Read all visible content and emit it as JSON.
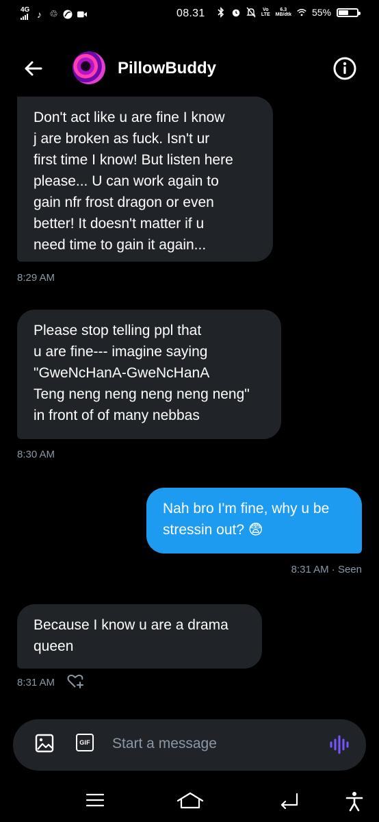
{
  "status_bar": {
    "network": "4G",
    "time": "08.31",
    "volte_line1": "Vo",
    "volte_line2": "LTE",
    "speed_line1": "6.3",
    "speed_line2": "MB/dtk",
    "battery_percent": "55%",
    "battery_level": 0.55
  },
  "header": {
    "title": "PillowBuddy"
  },
  "messages": [
    {
      "text": "Don't act like u are fine I know\nj are broken as fuck. Isn't ur\nfirst time I know! But listen here\nplease... U can work again to\ngain nfr frost dragon or even\nbetter! It doesn't matter if u\nneed time to gain it again...",
      "time": "8:29 AM"
    },
    {
      "text": "Please stop telling ppl that\nu are fine--- imagine saying\n\"GweNcHanA-GweNcHanA\nTeng neng neng neng neng neng\"\nin front of of many nebbas",
      "time": "8:30 AM"
    },
    {
      "text": "Nah bro I'm fine, why u be\nstressin out? 😨",
      "time": "8:31 AM · Seen"
    },
    {
      "text": "Because I know u are a drama\nqueen",
      "time": "8:31 AM"
    }
  ],
  "composer": {
    "gif_label": "GIF",
    "placeholder": "Start a message"
  },
  "colors": {
    "background": "#000000",
    "incoming_bubble": "#202327",
    "outgoing_bubble": "#1d9bf0",
    "timestamp": "#8b98a5",
    "voice_accent": "#7856ff"
  }
}
